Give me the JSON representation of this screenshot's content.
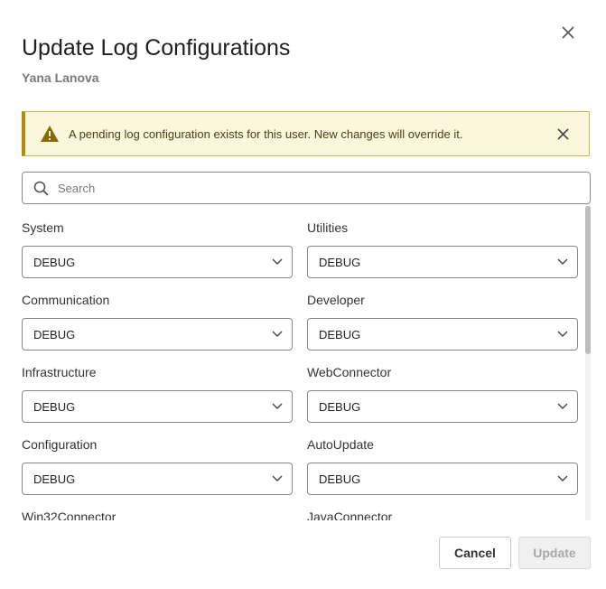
{
  "dialog": {
    "title": "Update Log Configurations",
    "subtitle": "Yana Lanova"
  },
  "banner": {
    "message": "A pending log configuration exists for this user. New changes will override it.",
    "icon": "warning-icon",
    "color": "#b68a07"
  },
  "search": {
    "placeholder": "Search",
    "value": ""
  },
  "fields": [
    {
      "label": "System",
      "value": "DEBUG"
    },
    {
      "label": "Utilities",
      "value": "DEBUG"
    },
    {
      "label": "Communication",
      "value": "DEBUG"
    },
    {
      "label": "Developer",
      "value": "DEBUG"
    },
    {
      "label": "Infrastructure",
      "value": "DEBUG"
    },
    {
      "label": "WebConnector",
      "value": "DEBUG"
    },
    {
      "label": "Configuration",
      "value": "DEBUG"
    },
    {
      "label": "AutoUpdate",
      "value": "DEBUG"
    },
    {
      "label": "Win32Connector",
      "value": ""
    },
    {
      "label": "JavaConnector",
      "value": ""
    }
  ],
  "footer": {
    "cancel_label": "Cancel",
    "update_label": "Update"
  }
}
